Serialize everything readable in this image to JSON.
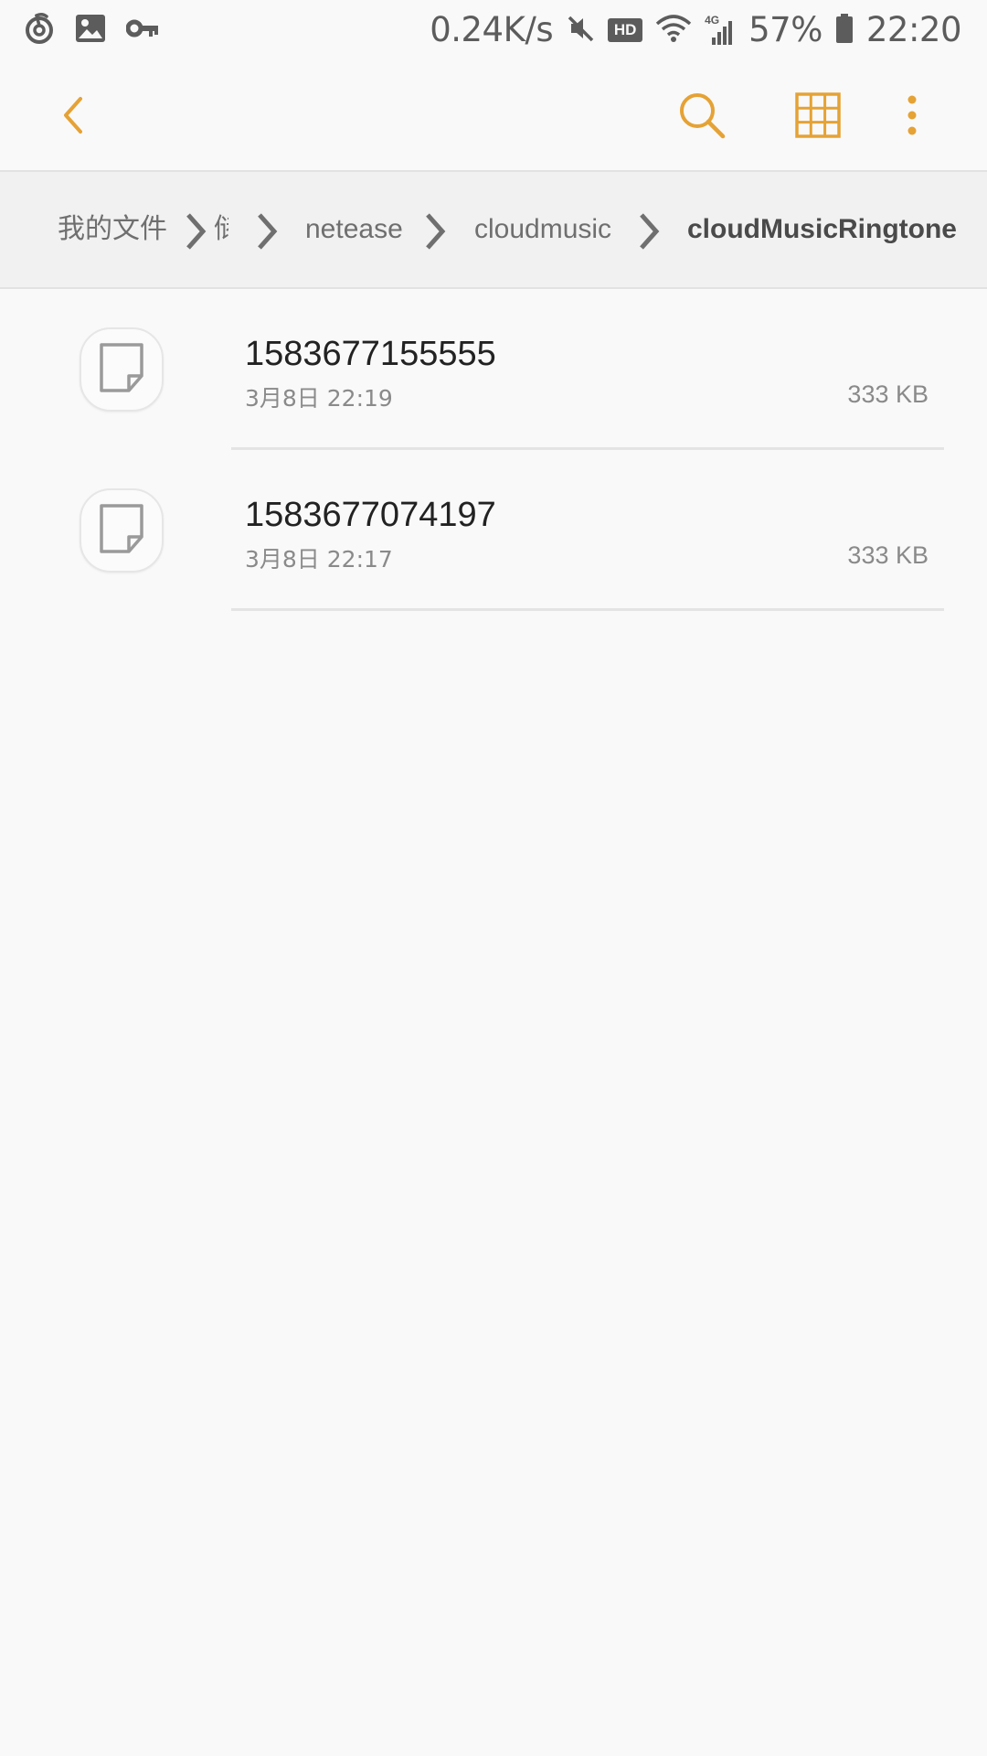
{
  "status_bar": {
    "net_speed": "0.24K/s",
    "hd": "HD",
    "network_type": "4G",
    "battery": "57%",
    "time": "22:20",
    "left_icons": [
      "netease-music-icon",
      "image-icon",
      "key-icon"
    ],
    "right_icons": [
      "mute-icon",
      "wifi-icon",
      "signal-icon",
      "battery-icon"
    ]
  },
  "app_bar": {
    "accent_color": "#e5a235",
    "icons": [
      "back-icon",
      "search-icon",
      "grid-view-icon",
      "more-options-icon"
    ]
  },
  "breadcrumb": {
    "items": [
      {
        "label": "我的文件"
      },
      {
        "label": "储"
      },
      {
        "label": "netease"
      },
      {
        "label": "cloudmusic"
      },
      {
        "label": "cloudMusicRingtone"
      }
    ]
  },
  "files": [
    {
      "name": "1583677155555",
      "date": "3月8日 22:19",
      "size": "333 KB",
      "icon": "document-icon"
    },
    {
      "name": "1583677074197",
      "date": "3月8日 22:17",
      "size": "333 KB",
      "icon": "document-icon"
    }
  ]
}
